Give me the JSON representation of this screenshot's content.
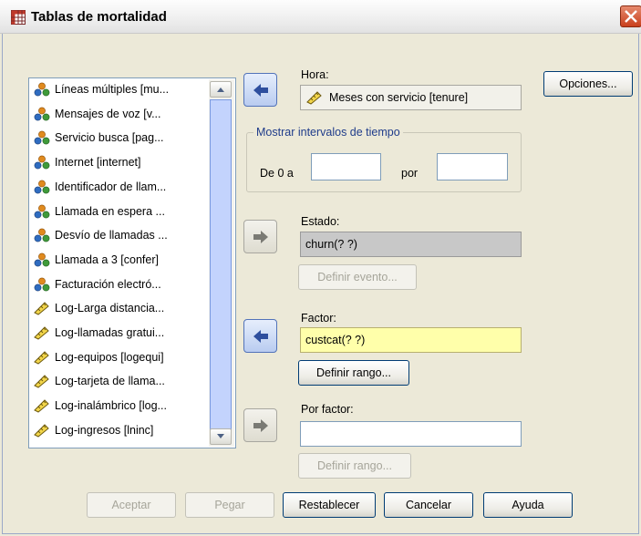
{
  "window": {
    "title": "Tablas de mortalidad"
  },
  "variables": [
    {
      "label": "Líneas múltiples [mu...",
      "icon": "nominal-icon"
    },
    {
      "label": "Mensajes de voz [v...",
      "icon": "nominal-icon"
    },
    {
      "label": "Servicio busca [pag...",
      "icon": "nominal-icon"
    },
    {
      "label": "Internet [internet]",
      "icon": "nominal-icon"
    },
    {
      "label": "Identificador de llam...",
      "icon": "nominal-icon"
    },
    {
      "label": "Llamada en espera ...",
      "icon": "nominal-icon"
    },
    {
      "label": "Desvío de llamadas ...",
      "icon": "nominal-icon"
    },
    {
      "label": "Llamada a 3 [confer]",
      "icon": "nominal-icon"
    },
    {
      "label": "Facturación electró...",
      "icon": "nominal-icon"
    },
    {
      "label": "Log-Larga distancia...",
      "icon": "scale-icon"
    },
    {
      "label": "Log-llamadas gratui...",
      "icon": "scale-icon"
    },
    {
      "label": "Log-equipos [logequi]",
      "icon": "scale-icon"
    },
    {
      "label": "Log-tarjeta de llama...",
      "icon": "scale-icon"
    },
    {
      "label": "Log-inalámbrico [log...",
      "icon": "scale-icon"
    },
    {
      "label": "Log-ingresos [lninc]",
      "icon": "scale-icon"
    }
  ],
  "hora": {
    "label": "Hora:",
    "value": "Meses con servicio [tenure]"
  },
  "intervals": {
    "legend": "Mostrar intervalos de tiempo",
    "from_label": "De 0 a",
    "step_label": "por",
    "to_value": "",
    "step_value": ""
  },
  "estado": {
    "label": "Estado:",
    "value": "churn(? ?)",
    "define_button": "Definir evento..."
  },
  "factor": {
    "label": "Factor:",
    "value": "custcat(? ?)",
    "define_button": "Definir rango..."
  },
  "por_factor": {
    "label": "Por factor:",
    "value": "",
    "define_button": "Definir rango..."
  },
  "options_button": "Opciones...",
  "footer": {
    "accept": "Aceptar",
    "paste": "Pegar",
    "reset": "Restablecer",
    "cancel": "Cancelar",
    "help": "Ayuda"
  },
  "colors": {
    "factor_field": "#ffffaa",
    "estado_field": "#c8c8c8",
    "legend_text": "#1f3c8a",
    "dialog_bg": "#ece9d8"
  }
}
